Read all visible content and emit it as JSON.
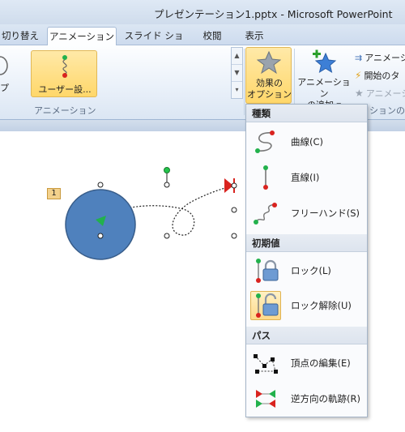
{
  "window": {
    "title": "プレゼンテーション1.pptx - Microsoft PowerPoint"
  },
  "tabs": [
    {
      "label": "切り替え"
    },
    {
      "label": "アニメーション"
    },
    {
      "label": "スライド ショー"
    },
    {
      "label": "校閲"
    },
    {
      "label": "表示"
    }
  ],
  "ribbon": {
    "partial_label": "プ",
    "user_path_button": "ユーザー設...",
    "group_animation_label": "アニメーション",
    "effect_options": {
      "line1": "効果の",
      "line2": "オプション"
    },
    "add_animation": {
      "line1": "アニメーション",
      "line2": "の追加"
    },
    "small_buttons": [
      {
        "label": "アニメーシ",
        "enabled": true
      },
      {
        "label": "開始のタ",
        "enabled": true
      },
      {
        "label": "アニメーシ",
        "enabled": false
      }
    ],
    "group_advanced_partial_label": "ションの"
  },
  "slide": {
    "animation_order_badge": "1"
  },
  "dropdown": {
    "sections": [
      {
        "header": "種類",
        "items": [
          {
            "label": "曲線(C)",
            "icon": "curve-path-icon",
            "selected": false
          },
          {
            "label": "直線(I)",
            "icon": "line-path-icon",
            "selected": false
          },
          {
            "label": "フリーハンド(S)",
            "icon": "freehand-path-icon",
            "selected": false
          }
        ]
      },
      {
        "header": "初期値",
        "items": [
          {
            "label": "ロック(L)",
            "icon": "lock-icon",
            "selected": false
          },
          {
            "label": "ロック解除(U)",
            "icon": "unlock-icon",
            "selected": true
          }
        ]
      },
      {
        "header": "パス",
        "items": [
          {
            "label": "頂点の編集(E)",
            "icon": "edit-points-icon",
            "selected": false
          },
          {
            "label": "逆方向の軌跡(R)",
            "icon": "reverse-path-icon",
            "selected": false
          }
        ]
      }
    ]
  },
  "colors": {
    "accent_highlight": "#ffd76a",
    "shape_fill": "#4f81bd",
    "path_start": "#22b14c",
    "path_end": "#d9231f"
  }
}
